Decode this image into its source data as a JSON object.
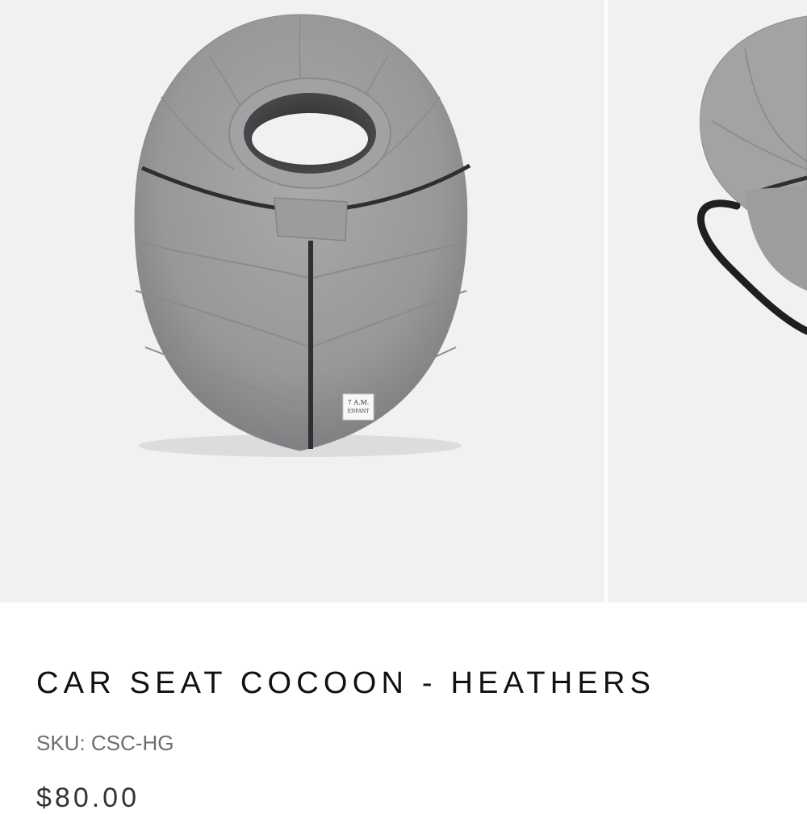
{
  "gallery": {
    "images": [
      {
        "alt": "product-photo-front",
        "label_text": "7 A.M. ENFANT"
      },
      {
        "alt": "product-photo-side"
      }
    ]
  },
  "product": {
    "title": "CAR SEAT COCOON - HEATHERS",
    "sku": "SKU: CSC-HG",
    "price": "$80.00"
  }
}
